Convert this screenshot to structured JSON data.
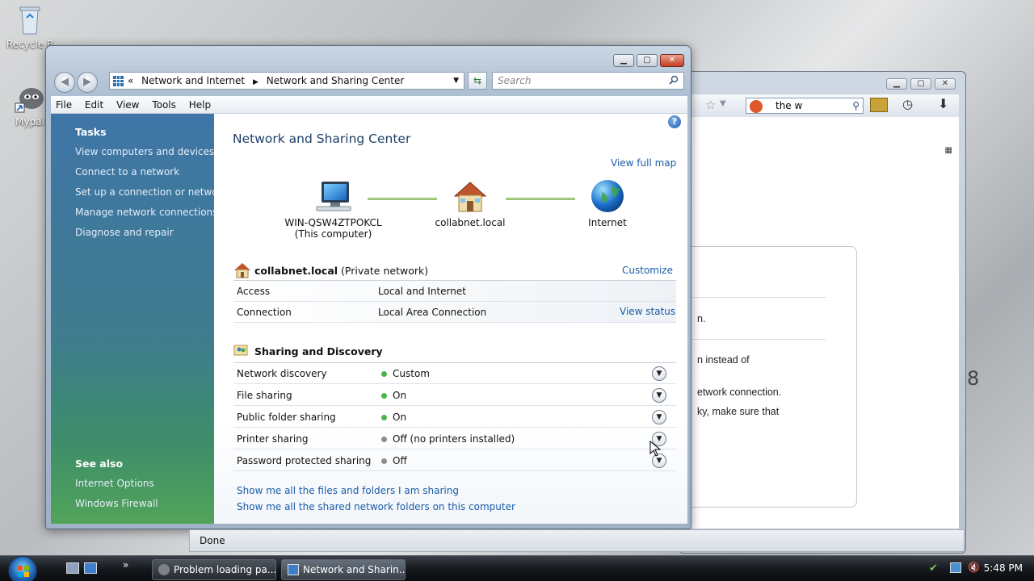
{
  "desktop": {
    "icons": [
      {
        "label": "Recycle B"
      },
      {
        "label": "Mypal"
      }
    ]
  },
  "background_window": {
    "search_text": "the w",
    "content_lines": [
      "n.",
      "n instead of",
      "etwork connection.",
      "ky, make sure that"
    ],
    "side_char": "8",
    "status": "Done"
  },
  "window": {
    "breadcrumbs": [
      "Network and Internet",
      "Network and Sharing Center"
    ],
    "breadcrumb_prefix": "«",
    "search_placeholder": "Search",
    "menu": [
      "File",
      "Edit",
      "View",
      "Tools",
      "Help"
    ],
    "sidebar": {
      "tasks_header": "Tasks",
      "tasks": [
        "View computers and devices",
        "Connect to a network",
        "Set up a connection or network",
        "Manage network connections",
        "Diagnose and repair"
      ],
      "see_also_header": "See also",
      "see_also": [
        "Internet Options",
        "Windows Firewall"
      ]
    },
    "main": {
      "title": "Network and Sharing Center",
      "view_full_map": "View full map",
      "map": {
        "computer_name": "WIN-QSW4ZTPOKCL",
        "computer_sub": "(This computer)",
        "network_name": "collabnet.local",
        "internet": "Internet"
      },
      "network": {
        "name": "collabnet.local",
        "type": "(Private network)",
        "customize": "Customize",
        "rows": [
          {
            "key": "Access",
            "value": "Local and Internet"
          },
          {
            "key": "Connection",
            "value": "Local Area Connection",
            "action": "View status"
          }
        ]
      },
      "sharing": {
        "header": "Sharing and Discovery",
        "rows": [
          {
            "key": "Network discovery",
            "value": "Custom",
            "state": "on"
          },
          {
            "key": "File sharing",
            "value": "On",
            "state": "on"
          },
          {
            "key": "Public folder sharing",
            "value": "On",
            "state": "on"
          },
          {
            "key": "Printer sharing",
            "value": "Off (no printers installed)",
            "state": "off"
          },
          {
            "key": "Password protected sharing",
            "value": "Off",
            "state": "off"
          }
        ]
      },
      "bottom_links": [
        "Show me all the files and folders I am sharing",
        "Show me all the shared network folders on this computer"
      ]
    }
  },
  "taskbar": {
    "tasks": [
      {
        "label": "Problem loading pa..."
      },
      {
        "label": "Network and Sharin..."
      }
    ],
    "clock": "5:48 PM"
  },
  "colors": {
    "link": "#1a5ca8",
    "status_on": "#49b449",
    "status_off": "#8c8c8c",
    "title": "#1e3f66"
  }
}
